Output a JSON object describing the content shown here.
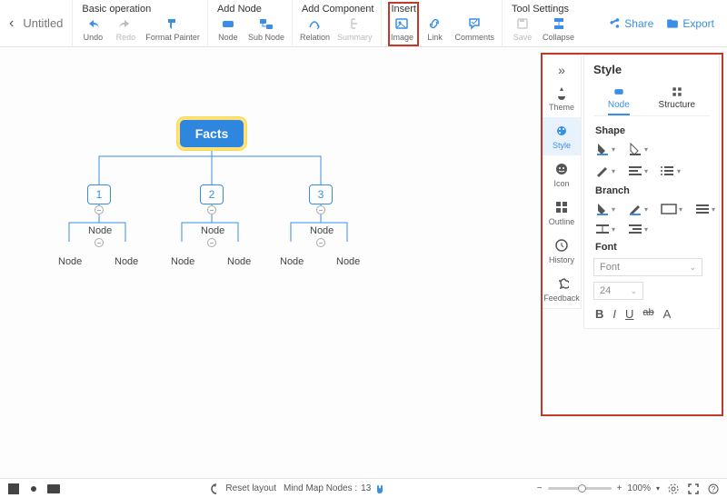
{
  "header": {
    "doc_title": "Untitled",
    "groups": [
      {
        "label": "Basic operation",
        "items": [
          {
            "id": "undo",
            "label": "Undo",
            "icon": "undo",
            "disabled": false
          },
          {
            "id": "redo",
            "label": "Redo",
            "icon": "redo",
            "disabled": true
          },
          {
            "id": "format-painter",
            "label": "Format Painter",
            "icon": "format-painter",
            "disabled": false
          }
        ]
      },
      {
        "label": "Add Node",
        "items": [
          {
            "id": "node",
            "label": "Node",
            "icon": "node",
            "disabled": false
          },
          {
            "id": "sub-node",
            "label": "Sub Node",
            "icon": "sub-node",
            "disabled": false
          }
        ]
      },
      {
        "label": "Add Component",
        "items": [
          {
            "id": "relation",
            "label": "Relation",
            "icon": "relation",
            "disabled": false
          },
          {
            "id": "summary",
            "label": "Summary",
            "icon": "summary",
            "disabled": true
          }
        ]
      },
      {
        "label": "Insert",
        "items": [
          {
            "id": "image",
            "label": "Image",
            "icon": "image",
            "disabled": false
          },
          {
            "id": "link",
            "label": "Link",
            "icon": "link",
            "disabled": false
          },
          {
            "id": "comments",
            "label": "Comments",
            "icon": "comments",
            "disabled": false
          }
        ]
      },
      {
        "label": "Tool Settings",
        "items": [
          {
            "id": "save",
            "label": "Save",
            "icon": "save",
            "disabled": true
          },
          {
            "id": "collapse",
            "label": "Collapse",
            "icon": "collapse",
            "disabled": false
          }
        ]
      }
    ],
    "share": "Share",
    "export": "Export"
  },
  "mindmap": {
    "root": "Facts",
    "level1": [
      "1",
      "2",
      "3"
    ],
    "level2_label": "Node",
    "level3_label": "Node"
  },
  "sidestrip": {
    "items": [
      {
        "id": "theme",
        "label": "Theme",
        "active": false
      },
      {
        "id": "style",
        "label": "Style",
        "active": true
      },
      {
        "id": "icon",
        "label": "Icon",
        "active": false
      },
      {
        "id": "outline",
        "label": "Outline",
        "active": false
      },
      {
        "id": "history",
        "label": "History",
        "active": false
      },
      {
        "id": "feedback",
        "label": "Feedback",
        "active": false
      }
    ]
  },
  "panel": {
    "title": "Style",
    "tabs": [
      {
        "id": "node",
        "label": "Node",
        "active": true
      },
      {
        "id": "structure",
        "label": "Structure",
        "active": false
      }
    ],
    "sections": {
      "shape": "Shape",
      "branch": "Branch",
      "font": "Font"
    },
    "font_select": "Font",
    "size_select": "24",
    "formats": {
      "bold": "B",
      "italic": "I",
      "underline": "U",
      "strike": "ab",
      "fontA": "A"
    }
  },
  "status": {
    "reset": "Reset layout",
    "nodes_label": "Mind Map Nodes :",
    "nodes_count": "13",
    "zoom": "100%"
  },
  "colors": {
    "accent": "#3a8ee6",
    "highlight": "#c0392b"
  }
}
